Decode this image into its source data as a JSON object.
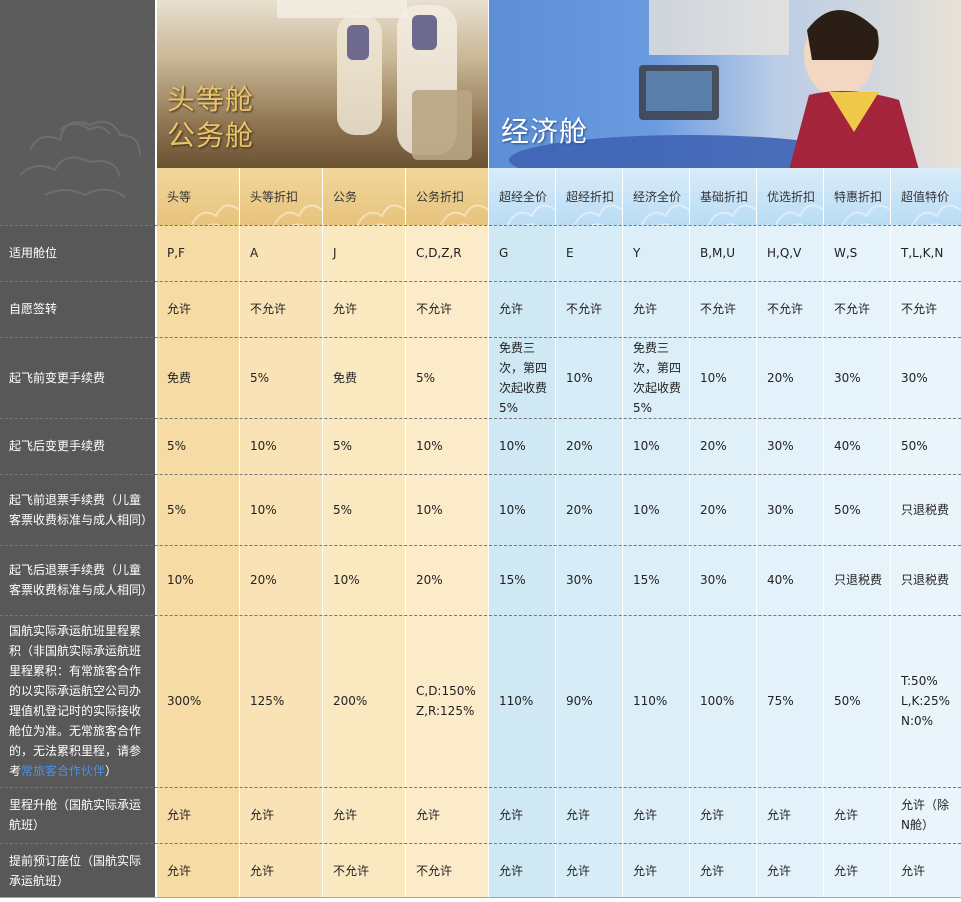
{
  "banners": {
    "premium": {
      "line1": "头等舱",
      "line2": "公务舱"
    },
    "economy": {
      "title": "经济舱"
    }
  },
  "columns": [
    {
      "id": "first",
      "label": "头等",
      "group": "premium"
    },
    {
      "id": "first-discount",
      "label": "头等折扣",
      "group": "premium"
    },
    {
      "id": "business",
      "label": "公务",
      "group": "premium"
    },
    {
      "id": "business-discount",
      "label": "公务折扣",
      "group": "premium"
    },
    {
      "id": "super-economy-full",
      "label": "超经全价",
      "group": "economy"
    },
    {
      "id": "super-economy-discount",
      "label": "超经折扣",
      "group": "economy"
    },
    {
      "id": "economy-full",
      "label": "经济全价",
      "group": "economy"
    },
    {
      "id": "basic-discount",
      "label": "基础折扣",
      "group": "economy"
    },
    {
      "id": "preferred-discount",
      "label": "优选折扣",
      "group": "economy"
    },
    {
      "id": "special-discount",
      "label": "特惠折扣",
      "group": "economy"
    },
    {
      "id": "super-value",
      "label": "超值特价",
      "group": "economy"
    }
  ],
  "rows": [
    {
      "label": "适用舱位",
      "cells": [
        "P,F",
        "A",
        "J",
        "C,D,Z,R",
        "G",
        "E",
        "Y",
        "B,M,U",
        "H,Q,V",
        "W,S",
        "T,L,K,N"
      ]
    },
    {
      "label": "自愿签转",
      "cells": [
        "允许",
        "不允许",
        "允许",
        "不允许",
        "允许",
        "不允许",
        "允许",
        "不允许",
        "不允许",
        "不允许",
        "不允许"
      ]
    },
    {
      "label": "起飞前变更手续费",
      "cells": [
        "免费",
        "5%",
        "免费",
        "5%",
        "免费三次，第四次起收费5%",
        "10%",
        "免费三次，第四次起收费5%",
        "10%",
        "20%",
        "30%",
        "30%"
      ]
    },
    {
      "label": "起飞后变更手续费",
      "cells": [
        "5%",
        "10%",
        "5%",
        "10%",
        "10%",
        "20%",
        "10%",
        "20%",
        "30%",
        "40%",
        "50%"
      ]
    },
    {
      "label": "起飞前退票手续费（儿童客票收费标准与成人相同）",
      "cells": [
        "5%",
        "10%",
        "5%",
        "10%",
        "10%",
        "20%",
        "10%",
        "20%",
        "30%",
        "50%",
        "只退税费"
      ]
    },
    {
      "label": "起飞后退票手续费（儿童客票收费标准与成人相同）",
      "cells": [
        "10%",
        "20%",
        "10%",
        "20%",
        "15%",
        "30%",
        "15%",
        "30%",
        "40%",
        "只退税费",
        "只退税费"
      ]
    },
    {
      "label": "国航实际承运航班里程累积（非国航实际承运航班里程累积：有常旅客合作的以实际承运航空公司办理值机登记时的实际接收舱位为准。无常旅客合作的，无法累积里程，请参考",
      "link": "常旅客合作伙伴",
      "label_end": "）",
      "cells": [
        "300%",
        "125%",
        "200%",
        "C,D:150% Z,R:125%",
        "110%",
        "90%",
        "110%",
        "100%",
        "75%",
        "50%",
        "T:50% L,K:25% N:0%"
      ]
    },
    {
      "label": "里程升舱（国航实际承运航班）",
      "cells": [
        "允许",
        "允许",
        "允许",
        "允许",
        "允许",
        "允许",
        "允许",
        "允许",
        "允许",
        "允许",
        "允许（除N舱）"
      ]
    },
    {
      "label": "提前预订座位（国航实际承运航班）",
      "cells": [
        "允许",
        "允许",
        "不允许",
        "不允许",
        "允许",
        "允许",
        "允许",
        "允许",
        "允许",
        "允许",
        "允许"
      ]
    }
  ],
  "colors": {
    "premium_header": "#e7c37c",
    "premium_cell": "#fae8c0",
    "economy_header": "#b9dcf4",
    "economy_cell": "#e3f1fa",
    "label_bg": "#585858",
    "link": "#4a90e2"
  }
}
